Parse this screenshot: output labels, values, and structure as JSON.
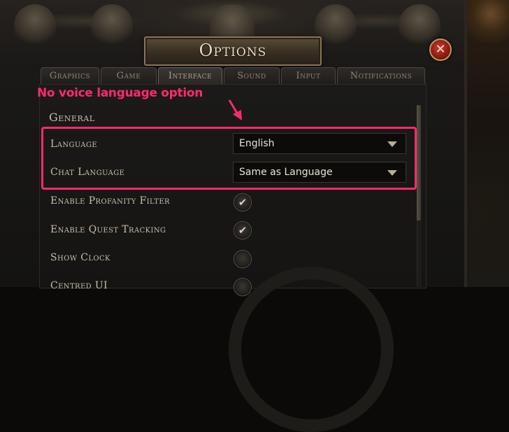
{
  "window": {
    "title": "Options",
    "close_glyph": "✕"
  },
  "tabs": [
    {
      "label": "Graphics",
      "active": false
    },
    {
      "label": "Game",
      "active": false
    },
    {
      "label": "Interface",
      "active": true
    },
    {
      "label": "Sound",
      "active": false
    },
    {
      "label": "Input",
      "active": false
    },
    {
      "label": "Notifications",
      "active": false
    }
  ],
  "section": {
    "title": "General"
  },
  "settings": {
    "language": {
      "label": "Language",
      "value": "English"
    },
    "chat_language": {
      "label": "Chat Language",
      "value": "Same as Language"
    },
    "profanity_filter": {
      "label": "Enable Profanity Filter",
      "checked": true,
      "glyph": "✔"
    },
    "quest_tracking": {
      "label": "Enable Quest Tracking",
      "checked": true,
      "glyph": "✔"
    },
    "show_clock": {
      "label": "Show Clock",
      "checked": false
    },
    "centred_ui": {
      "label": "Centred UI",
      "checked": false
    }
  },
  "annotation": {
    "text": "No voice language option",
    "color": "#ff2a6d"
  },
  "colors": {
    "accent": "#ff2a6d",
    "text": "#c9bfae",
    "title": "#e9dcc0"
  }
}
